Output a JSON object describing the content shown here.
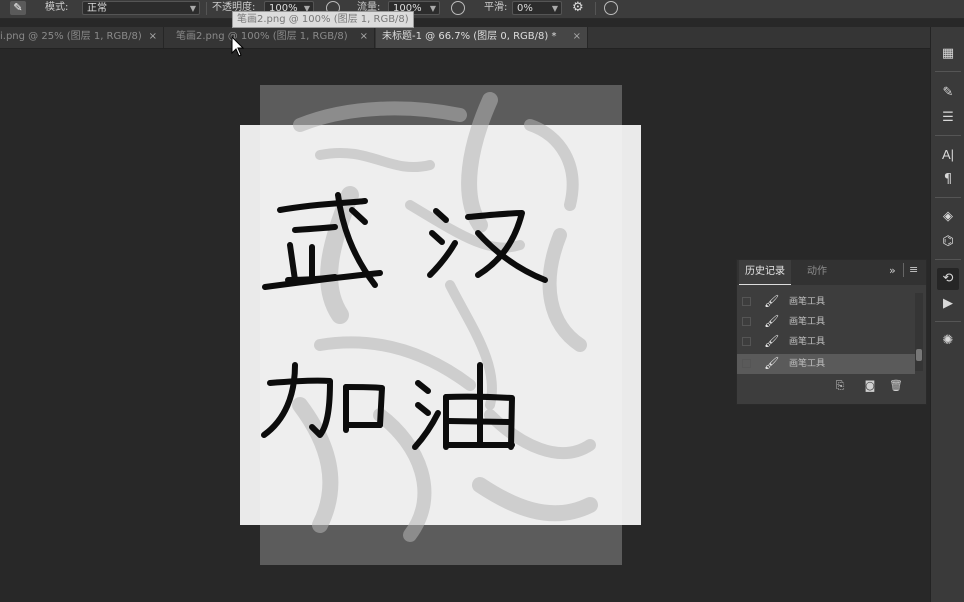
{
  "options_bar": {
    "mode_label": "模式:",
    "mode_value": "正常",
    "opacity_label": "不透明度:",
    "opacity_value": "100%",
    "flow_label": "流量:",
    "flow_value": "100%",
    "smoothing_label": "平滑:",
    "smoothing_value": "0%"
  },
  "tooltip": "笔画2.png @ 100% (图层 1, RGB/8)",
  "tabs": [
    {
      "label": "i.png @ 25% (图层 1, RGB/8)",
      "close": "×"
    },
    {
      "label": "笔画2.png @ 100% (图层 1, RGB/8)",
      "close": "×"
    },
    {
      "label": "未标题-1 @ 66.7% (图层 0, RGB/8) *",
      "close": "×"
    }
  ],
  "history_panel": {
    "tabs": [
      "历史记录",
      "动作"
    ],
    "menu_glyph": "»",
    "items": [
      "画笔工具",
      "画笔工具",
      "画笔工具",
      "画笔工具"
    ],
    "selected_index": 3
  },
  "canvas_text": [
    "武",
    "汉",
    "加",
    "油"
  ],
  "icons": {
    "tool": "brush-tool-icon",
    "right_toolbar": [
      "libraries-icon",
      "brush-settings-icon",
      "adjustments-icon",
      "character-icon",
      "paragraph-icon",
      "channels-icon",
      "paths-icon",
      "history-icon",
      "actions-icon",
      "properties-icon"
    ]
  },
  "colors": {
    "accent": "#dddddd",
    "canvas_bg": "#282828",
    "panel_bg": "#3d3d3d"
  }
}
